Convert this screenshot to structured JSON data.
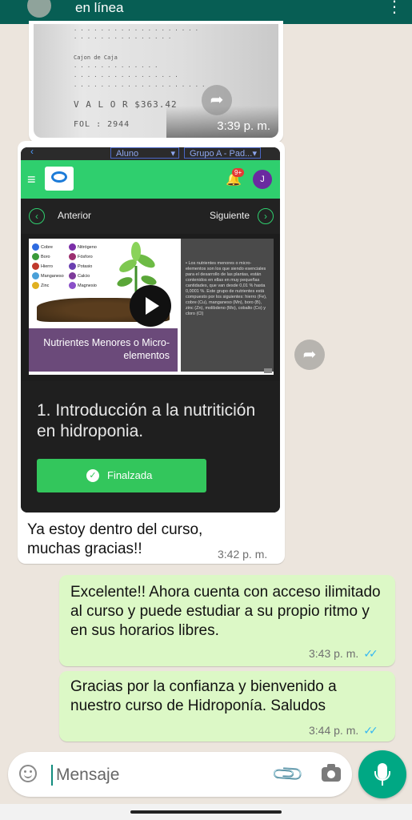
{
  "header": {
    "status": "en línea"
  },
  "receipt": {
    "time": "3:39 p. m.",
    "lines": [
      "Cajon de Caja",
      "V A L O R  $363.42",
      "FOL : 2944"
    ]
  },
  "course": {
    "top_tabs": [
      "Aluno",
      "Grupo A - Pad..."
    ],
    "badge": "9+",
    "user_initial": "J",
    "nav_prev": "Anterior",
    "nav_next": "Siguiente",
    "elements": [
      "Cobre",
      "Nitrógeno",
      "Boro",
      "Fósforo",
      "Hierro",
      "Potasio",
      "Manganeso",
      "Calcio",
      "Zinc",
      "Magnesio"
    ],
    "element_colors": [
      "#2e6be0",
      "#7b2fa8",
      "#3a9a3a",
      "#9b2f6f",
      "#c0392b",
      "#6a3fb0",
      "#4aa0d8",
      "#7d3b9a",
      "#e0b020",
      "#8a4fc8"
    ],
    "slide_title": "Nutrientes Menores o Micro-elementos",
    "slide_text": "• Los nutrientes menores o micro-elementos son los que siendo esenciales para el desarrollo de las plantas, están contenidos en ellas en muy pequeñas cantidades, que van desde 0,01 % hasta 0,0001 %. Este grupo de nutrientes está compuesto por los siguientes: hierro (Fe), cobre (Cu), manganeso (Mn), boro (B), zinc (Zn), molibdeno (Mo), cobalto (Co) y cloro (Cl)",
    "lesson_title": "1. Introducción a la nutritición en hidroponia.",
    "done_label": "Finalzada"
  },
  "messages": [
    {
      "text": "Ya estoy dentro del curso, muchas gracias!!",
      "time": "3:42 p. m."
    },
    {
      "text": "Excelente!! Ahora cuenta con acceso ilimitado al curso y puede estudiar a su propio ritmo y en sus horarios libres.",
      "time": "3:43 p. m."
    },
    {
      "text": "Gracias por la confianza y bienvenido a nuestro curso de Hidroponía. Saludos",
      "time": "3:44 p. m."
    }
  ],
  "input": {
    "placeholder": "Mensaje"
  },
  "colors": {
    "header": "#075e54",
    "outgoing": "#dcf8c6",
    "accent": "#00a884",
    "read_ticks": "#34b7f1"
  },
  "icons": [
    "more-icon",
    "forward-icon",
    "play-icon",
    "check-icon",
    "emoji-icon",
    "attach-icon",
    "camera-icon",
    "mic-icon"
  ]
}
